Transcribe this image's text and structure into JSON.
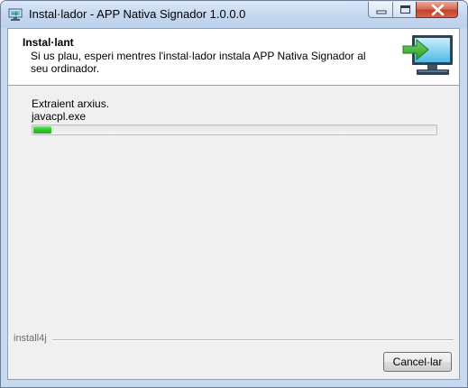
{
  "window": {
    "title": "Instal·lador - APP Nativa Signador 1.0.0.0",
    "controls": [
      "minimize-icon",
      "maximize-icon",
      "close-icon"
    ]
  },
  "header": {
    "title": "Instal·lant",
    "description": "Si us plau, esperi mentres l'instal·lador instala APP Nativa Signador al seu ordinador.",
    "icon": "computer-install-icon"
  },
  "progress": {
    "status": "Extraient arxius.",
    "current_file": "javacpl.exe",
    "percent": 4.5
  },
  "footer": {
    "brand": "install4j",
    "cancel_label": "Cancel·lar"
  },
  "colors": {
    "progress_fill": "#2fc42b",
    "titlebar": "#c6d8f0",
    "client_bg": "#f0f0f0"
  }
}
